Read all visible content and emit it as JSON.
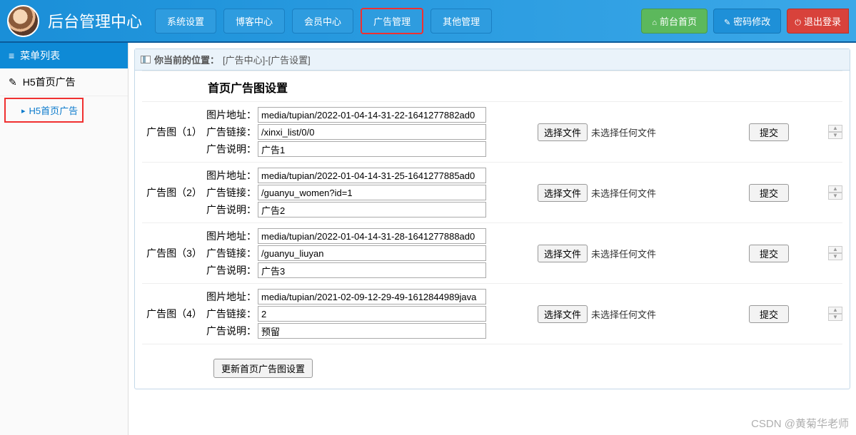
{
  "header": {
    "title": "后台管理中心",
    "nav": [
      "系统设置",
      "博客中心",
      "会员中心",
      "广告管理",
      "其他管理"
    ],
    "btn_front": "前台首页",
    "btn_pwd": "密码修改",
    "btn_logout": "退出登录"
  },
  "sidebar": {
    "head": "菜单列表",
    "section": "H5首页广告",
    "sub": "H5首页广告"
  },
  "breadcrumb": {
    "prefix": "你当前的位置：",
    "path": "[广告中心]-[广告设置]"
  },
  "panel_title": "首页广告图设置",
  "labels": {
    "img_url": "图片地址：",
    "ad_link": "广告链接：",
    "ad_desc": "广告说明：",
    "choose_file": "选择文件",
    "no_file": "未选择任何文件",
    "submit": "提交",
    "update": "更新首页广告图设置"
  },
  "rows": [
    {
      "name": "广告图（1）",
      "img": "media/tupian/2022-01-04-14-31-22-1641277882ad0",
      "link": "/xinxi_list/0/0",
      "desc": "广告1"
    },
    {
      "name": "广告图（2）",
      "img": "media/tupian/2022-01-04-14-31-25-1641277885ad0",
      "link": "/guanyu_women?id=1",
      "desc": "广告2"
    },
    {
      "name": "广告图（3）",
      "img": "media/tupian/2022-01-04-14-31-28-1641277888ad0",
      "link": "/guanyu_liuyan",
      "desc": "广告3"
    },
    {
      "name": "广告图（4）",
      "img": "media/tupian/2021-02-09-12-29-49-1612844989java",
      "link": "2",
      "desc": "预留"
    }
  ],
  "watermark": "CSDN @黄菊华老师"
}
